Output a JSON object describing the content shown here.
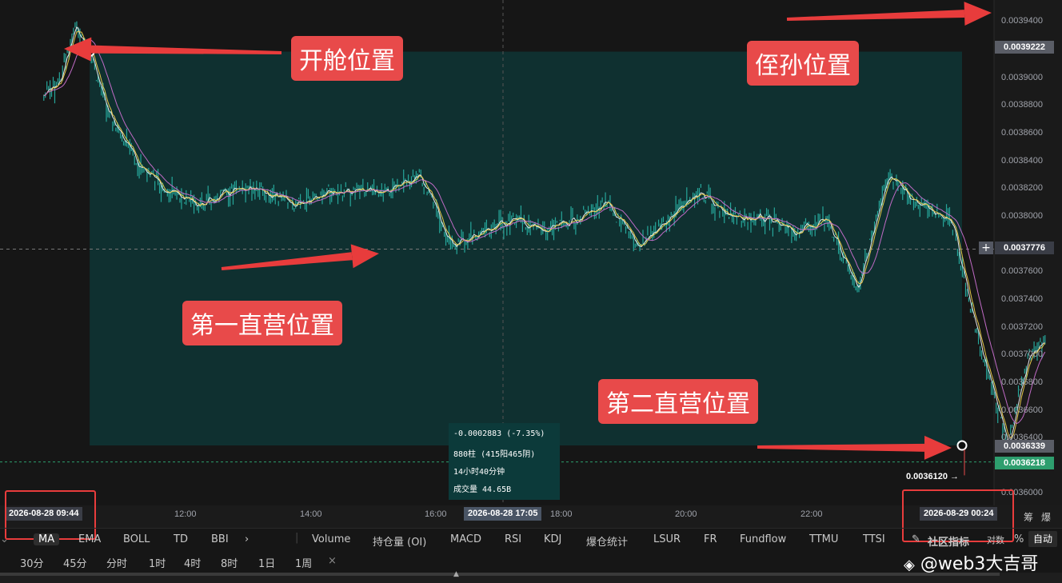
{
  "chart_data": {
    "type": "line",
    "title": "",
    "subtitle": "",
    "xlabel": "",
    "ylabel": "",
    "ylim": [
      0.00359,
      0.00396
    ],
    "grid": false,
    "x_ticks": [
      "12:00",
      "14:00",
      "16:00",
      "18:00",
      "20:00",
      "22:00"
    ],
    "y_ticks": [
      "0.0039400",
      "0.0039000",
      "0.0038800",
      "0.0038600",
      "0.0038400",
      "0.0038200",
      "0.0038000",
      "0.0037600",
      "0.0037400",
      "0.0037200",
      "0.0037000",
      "0.0036800",
      "0.0036600",
      "0.0036400",
      "0.0036000"
    ],
    "price_series": [
      {
        "t": "2026-08-28 09:00",
        "v": 0.00389
      },
      {
        "t": "2026-08-28 09:15",
        "v": 0.0039
      },
      {
        "t": "2026-08-28 09:30",
        "v": 0.00394
      },
      {
        "t": "2026-08-28 09:44",
        "v": 0.0039222
      },
      {
        "t": "2026-08-28 10:00",
        "v": 0.00388
      },
      {
        "t": "2026-08-28 10:30",
        "v": 0.00384
      },
      {
        "t": "2026-08-28 11:00",
        "v": 0.00382
      },
      {
        "t": "2026-08-28 11:30",
        "v": 0.00381
      },
      {
        "t": "2026-08-28 12:00",
        "v": 0.00382
      },
      {
        "t": "2026-08-28 12:30",
        "v": 0.00382
      },
      {
        "t": "2026-08-28 13:00",
        "v": 0.00381
      },
      {
        "t": "2026-08-28 13:30",
        "v": 0.00382
      },
      {
        "t": "2026-08-28 14:00",
        "v": 0.00382
      },
      {
        "t": "2026-08-28 14:30",
        "v": 0.00382
      },
      {
        "t": "2026-08-28 15:00",
        "v": 0.00383
      },
      {
        "t": "2026-08-28 15:15",
        "v": 0.00381
      },
      {
        "t": "2026-08-28 15:30",
        "v": 0.00378
      },
      {
        "t": "2026-08-28 16:00",
        "v": 0.00379
      },
      {
        "t": "2026-08-28 16:30",
        "v": 0.0038
      },
      {
        "t": "2026-08-28 17:00",
        "v": 0.00379
      },
      {
        "t": "2026-08-28 17:30",
        "v": 0.0038
      },
      {
        "t": "2026-08-28 18:00",
        "v": 0.00381
      },
      {
        "t": "2026-08-28 18:30",
        "v": 0.00378
      },
      {
        "t": "2026-08-28 19:00",
        "v": 0.0038
      },
      {
        "t": "2026-08-28 19:30",
        "v": 0.00382
      },
      {
        "t": "2026-08-28 20:00",
        "v": 0.0038
      },
      {
        "t": "2026-08-28 20:30",
        "v": 0.0038
      },
      {
        "t": "2026-08-28 21:00",
        "v": 0.00379
      },
      {
        "t": "2026-08-28 21:30",
        "v": 0.0038
      },
      {
        "t": "2026-08-28 22:00",
        "v": 0.00375
      },
      {
        "t": "2026-08-28 22:30",
        "v": 0.00383
      },
      {
        "t": "2026-08-28 23:00",
        "v": 0.00381
      },
      {
        "t": "2026-08-28 23:30",
        "v": 0.0038
      },
      {
        "t": "2026-08-28 23:50",
        "v": 0.00373
      },
      {
        "t": "2026-08-29 00:24",
        "v": 0.0036339
      },
      {
        "t": "2026-08-29 00:45",
        "v": 0.0037
      },
      {
        "t": "2026-08-29 01:00",
        "v": 0.00371
      }
    ],
    "measure_range": {
      "from_price": 0.0039222,
      "to_price": 0.0036339,
      "from_time": "2026-08-28 09:44",
      "to_time": "2026-08-29 00:24"
    }
  },
  "colors": {
    "background": "#161616",
    "range_fill": "#0e3535",
    "candle_up": "#26a69a",
    "candle_down": "#26a69a",
    "ma_yellow": "#e6c84a",
    "ma_white": "#e8e8e8",
    "ma_purple": "#c06bc6",
    "annotation": "#e84a4a",
    "current_price": "#2e9e6e"
  },
  "annotations": {
    "open": "开舱位置",
    "stop": "侄孙位置",
    "first": "第一直营位置",
    "second": "第二直营位置"
  },
  "price_labels": {
    "open_price": "0.0039222",
    "crosshair_price": "0.0037776",
    "end_price": "0.0036339",
    "current_price": "0.0036218",
    "low_marker": "0.0036120 →"
  },
  "time_labels": {
    "start": "2026-08-28 09:44",
    "crosshair": "2026-08-28 17:05",
    "end": "2026-08-29 00:24"
  },
  "info_box": {
    "change": "-0.0002883 (-7.35%)",
    "bars": "880柱 (415阳465阴)",
    "duration": "14小时40分钟",
    "volume": "成交量 44.65B"
  },
  "indicator_bar": {
    "items": [
      "MA",
      "EMA",
      "BOLL",
      "TD",
      "BBI",
      "›",
      "Volume",
      "持仓量 (OI)",
      "MACD",
      "RSI",
      "KDJ",
      "爆仓统计",
      "LSUR",
      "FR",
      "Fundflow",
      "TTMU",
      "TTSI"
    ],
    "community": "社区指标",
    "log": "对数",
    "percent": "%",
    "auto": "自动",
    "right1": "筹",
    "right2": "爆"
  },
  "interval_bar": {
    "items": [
      "30分",
      "45分",
      "分时",
      "1时",
      "4时",
      "8时",
      "1日",
      "1周",
      "×"
    ]
  },
  "watermark": "@web3大吉哥"
}
